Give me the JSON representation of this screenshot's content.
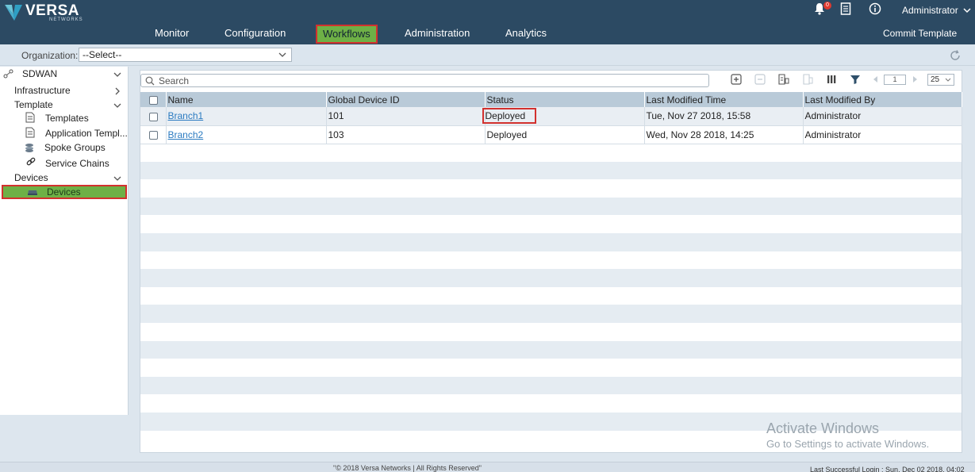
{
  "brand": {
    "name": "VERSA",
    "sub": "NETWORKS"
  },
  "nav": {
    "monitor": "Monitor",
    "configuration": "Configuration",
    "workflows": "Workflows",
    "administration": "Administration",
    "analytics": "Analytics",
    "commit": "Commit Template"
  },
  "topbar": {
    "notification_count": "0",
    "user": "Administrator"
  },
  "org": {
    "label": "Organization:",
    "selected": "--Select--"
  },
  "sidebar": {
    "root": "SDWAN",
    "infrastructure": "Infrastructure",
    "template": "Template",
    "templates": "Templates",
    "app_templates": "Application Templ...",
    "spoke_groups": "Spoke Groups",
    "service_chains": "Service Chains",
    "devices_group": "Devices",
    "devices": "Devices"
  },
  "search": {
    "placeholder": "Search"
  },
  "pager": {
    "page": "1",
    "page_size": "25"
  },
  "table": {
    "headers": [
      "Name",
      "Global Device ID",
      "Status",
      "Last Modified Time",
      "Last Modified By"
    ],
    "rows": [
      {
        "name": "Branch1",
        "id": "101",
        "status": "Deployed",
        "time": "Tue, Nov 27 2018, 15:58",
        "by": "Administrator"
      },
      {
        "name": "Branch2",
        "id": "103",
        "status": "Deployed",
        "time": "Wed, Nov 28 2018, 14:25",
        "by": "Administrator"
      }
    ]
  },
  "watermark": {
    "line1": "Activate Windows",
    "line2": "Go to Settings to activate Windows."
  },
  "footer": {
    "copyright": "\"© 2018 Versa Networks | All Rights Reserved\"",
    "last_login": "Last Successful Login : Sun, Dec 02 2018, 04:02"
  },
  "colors": {
    "topbar": "#2c4a63",
    "active_green": "#6eb046",
    "highlight_red": "#d2312e",
    "link": "#2b7bc1"
  }
}
